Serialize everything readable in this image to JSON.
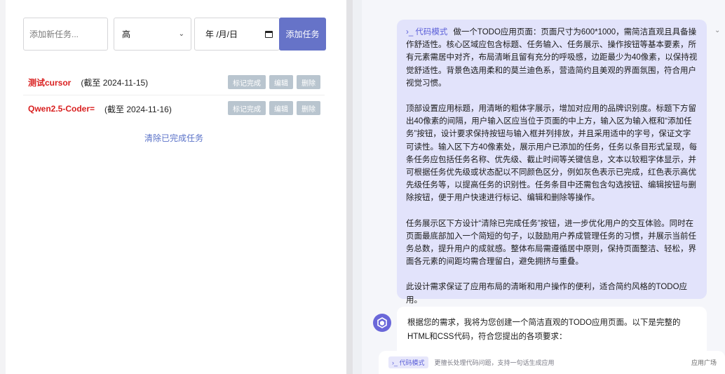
{
  "todo_app": {
    "task_input_placeholder": "添加新任务...",
    "priority_value": "高",
    "date_value": "年 /月/日",
    "add_button": "添加任务",
    "tasks": [
      {
        "name": "测试cursor",
        "due": "(截至 2024-11-15)"
      },
      {
        "name": "Qwen2.5-Coder=",
        "due": "(截至 2024-11-16)"
      }
    ],
    "action_labels": {
      "complete": "标记完成",
      "edit": "编辑",
      "delete": "删除"
    },
    "clear_completed": "清除已完成任务"
  },
  "chat": {
    "mode_tag": "›_ 代码模式",
    "user_message_paragraphs": [
      "做一个TODO应用页面：页面尺寸为600*1000，需简洁直观且具备操作舒适性。核心区域应包含标题、任务输入、任务展示、操作按钮等基本要素，所有元素需居中对齐，布局清晰且留有充分的呼吸感，边距最少为40像素，以保持视觉舒适性。背景色选用柔和的莫兰迪色系，营造简约且美观的界面氛围，符合用户视觉习惯。",
      "顶部设置应用标题，用清晰的粗体字展示，增加对应用的品牌识别度。标题下方留出40像素的间隔，用户输入区应当位于页面的中上方，输入区为输入框和“添加任务”按钮，设计要求保持按钮与输入框并列排放，并且采用适中的字号，保证文字可读性。输入区下方40像素处，展示用户已添加的任务，任务以条目形式呈现，每条任务应包括任务名称、优先级、截止时间等关键信息，文本以较粗字体显示，并可根据任务优先级或状态配以不同颜色区分，例如灰色表示已完成，红色表示高优先级任务等，以提高任务的识别性。任务条目中还需包含勾选按钮、编辑按钮与删除按钮，便于用户快速进行标记、编辑和删除等操作。",
      "任务展示区下方设计“清除已完成任务”按钮，进一步优化用户的交互体验。同时在页面最底部加入一个简短的句子，以鼓励用户养成管理任务的习惯，并展示当前任务总数，提升用户的成就感。整体布局需遵循居中原则，保持页面整洁、轻松，界面各元素的间距均需合理留白，避免拥挤与重叠。",
      "此设计需求保证了应用布局的清晰和用户操作的便利，适合简约风格的TODO应用。"
    ],
    "bot_reply": "根据您的需求，我将为您创建一个简洁直观的TODO应用页面。以下是完整的HTML和CSS代码，符合您提出的各项要求：",
    "composer_mode_chip": "›_ 代码模式",
    "composer_hint": "更擅长处理代码问题，支持一句话生成应用",
    "app_plaza": "应用广场"
  },
  "colors": {
    "accent": "#6673c8",
    "high_priority": "#d92020",
    "user_bubble": "#e2e3fb",
    "bot_avatar": "#6a67d9"
  },
  "icons": [
    "chevron-down-icon",
    "calendar-icon",
    "bot-avatar-icon",
    "scroll-down-arrow-icon",
    "collapse-chevron-icon"
  ]
}
